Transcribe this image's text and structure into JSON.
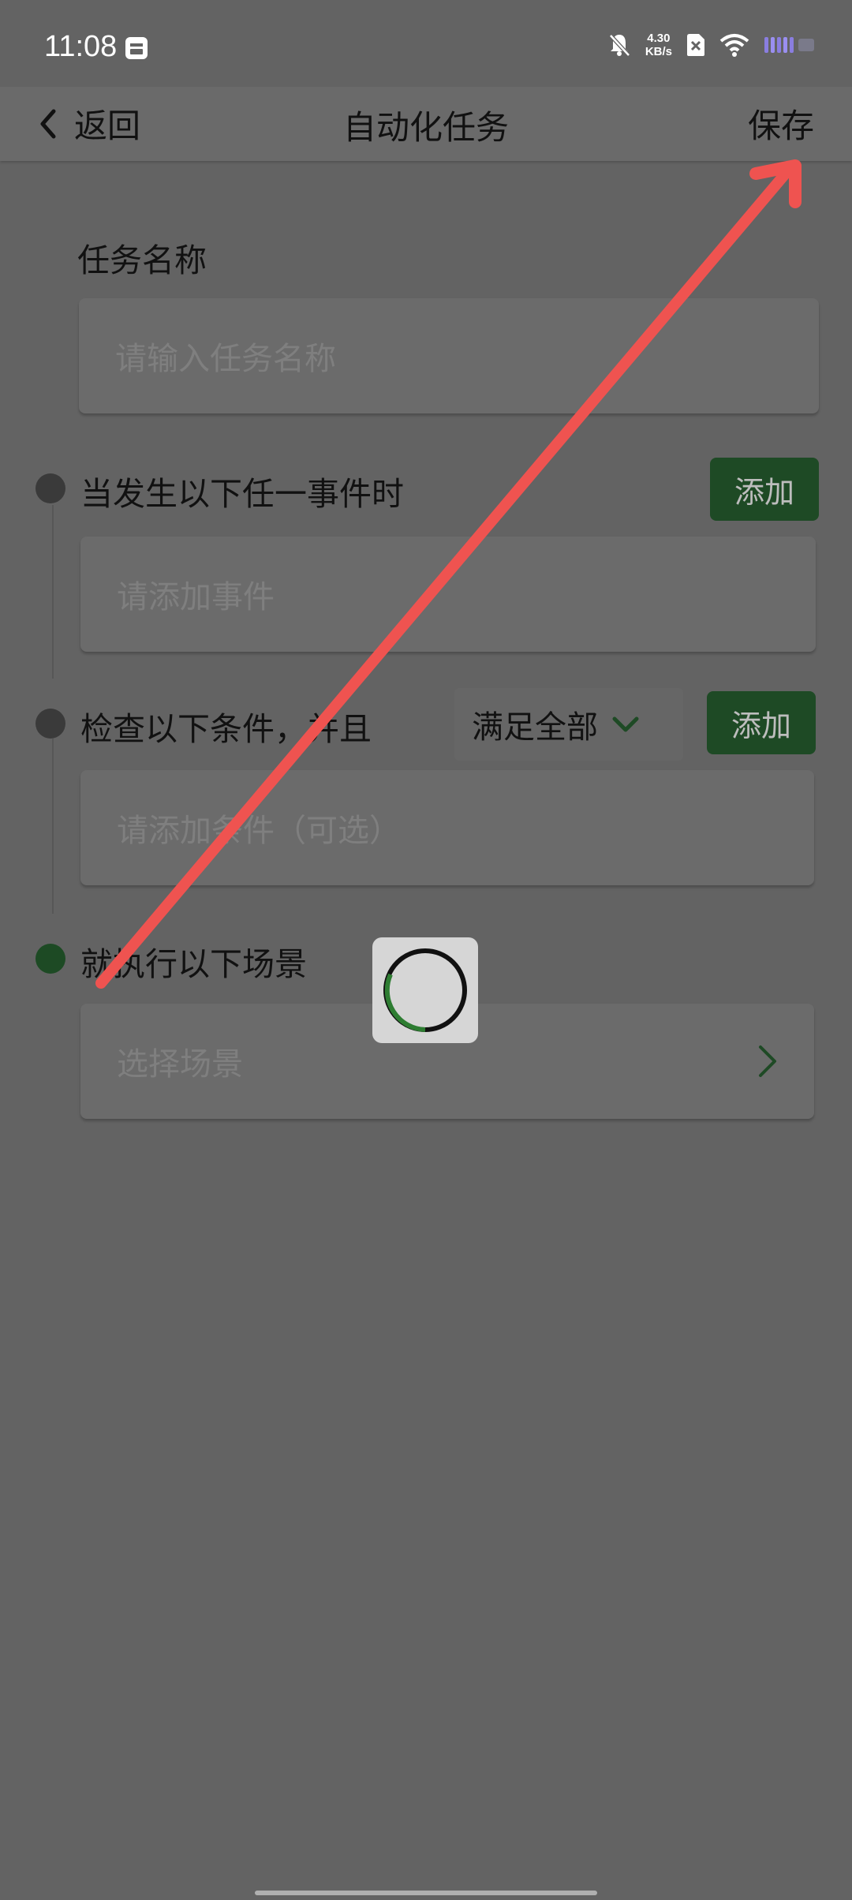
{
  "status_bar": {
    "time": "11:08",
    "speed_value": "4.30",
    "speed_unit": "KB/s"
  },
  "header": {
    "back_label": "返回",
    "title": "自动化任务",
    "save_label": "保存"
  },
  "task_name": {
    "label": "任务名称",
    "placeholder": "请输入任务名称",
    "value": ""
  },
  "events": {
    "label": "当发生以下任一事件时",
    "add_label": "添加",
    "placeholder": "请添加事件"
  },
  "conditions": {
    "label": "检查以下条件，并且",
    "match_mode": "满足全部",
    "add_label": "添加",
    "placeholder": "请添加条件（可选）"
  },
  "scene": {
    "label": "就执行以下场景",
    "placeholder": "选择场景"
  },
  "colors": {
    "accent_green": "#1e4a25",
    "overlay_arrow": "#ef5350"
  }
}
